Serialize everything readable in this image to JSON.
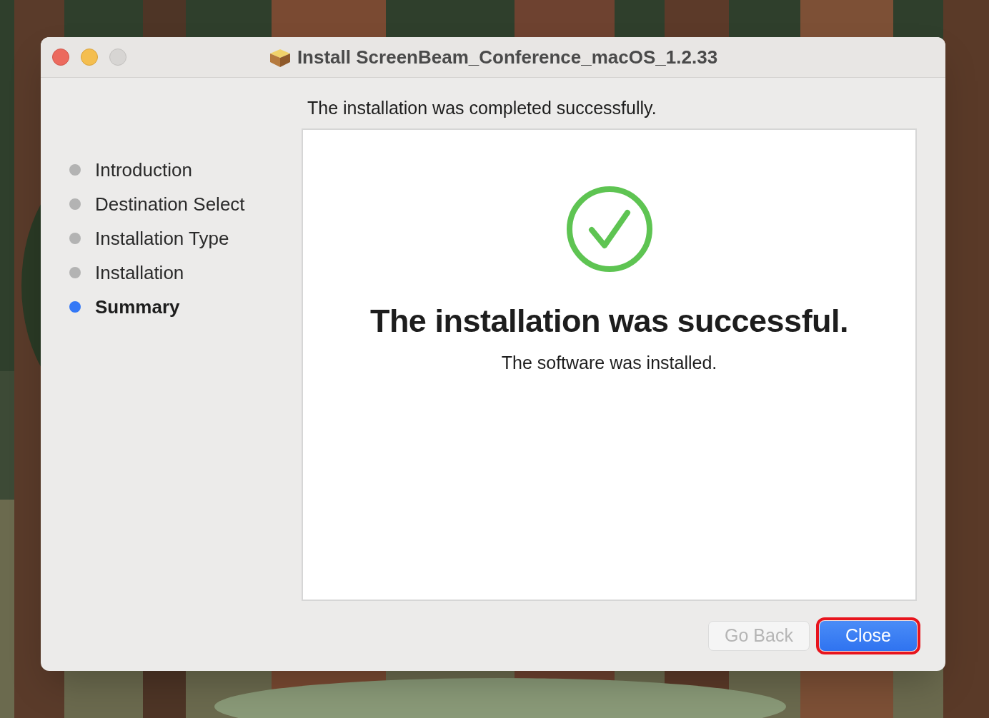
{
  "window": {
    "title": "Install ScreenBeam_Conference_macOS_1.2.33"
  },
  "steps": [
    {
      "label": "Introduction",
      "selected": false
    },
    {
      "label": "Destination Select",
      "selected": false
    },
    {
      "label": "Installation Type",
      "selected": false
    },
    {
      "label": "Installation",
      "selected": false
    },
    {
      "label": "Summary",
      "selected": true
    }
  ],
  "header": "The installation was completed successfully.",
  "result": {
    "heading": "The installation was successful.",
    "message": "The software was installed."
  },
  "buttons": [
    {
      "label": "Go Back",
      "disabled": true,
      "highlighted": false
    },
    {
      "label": "Close",
      "disabled": false,
      "highlighted": true
    }
  ]
}
